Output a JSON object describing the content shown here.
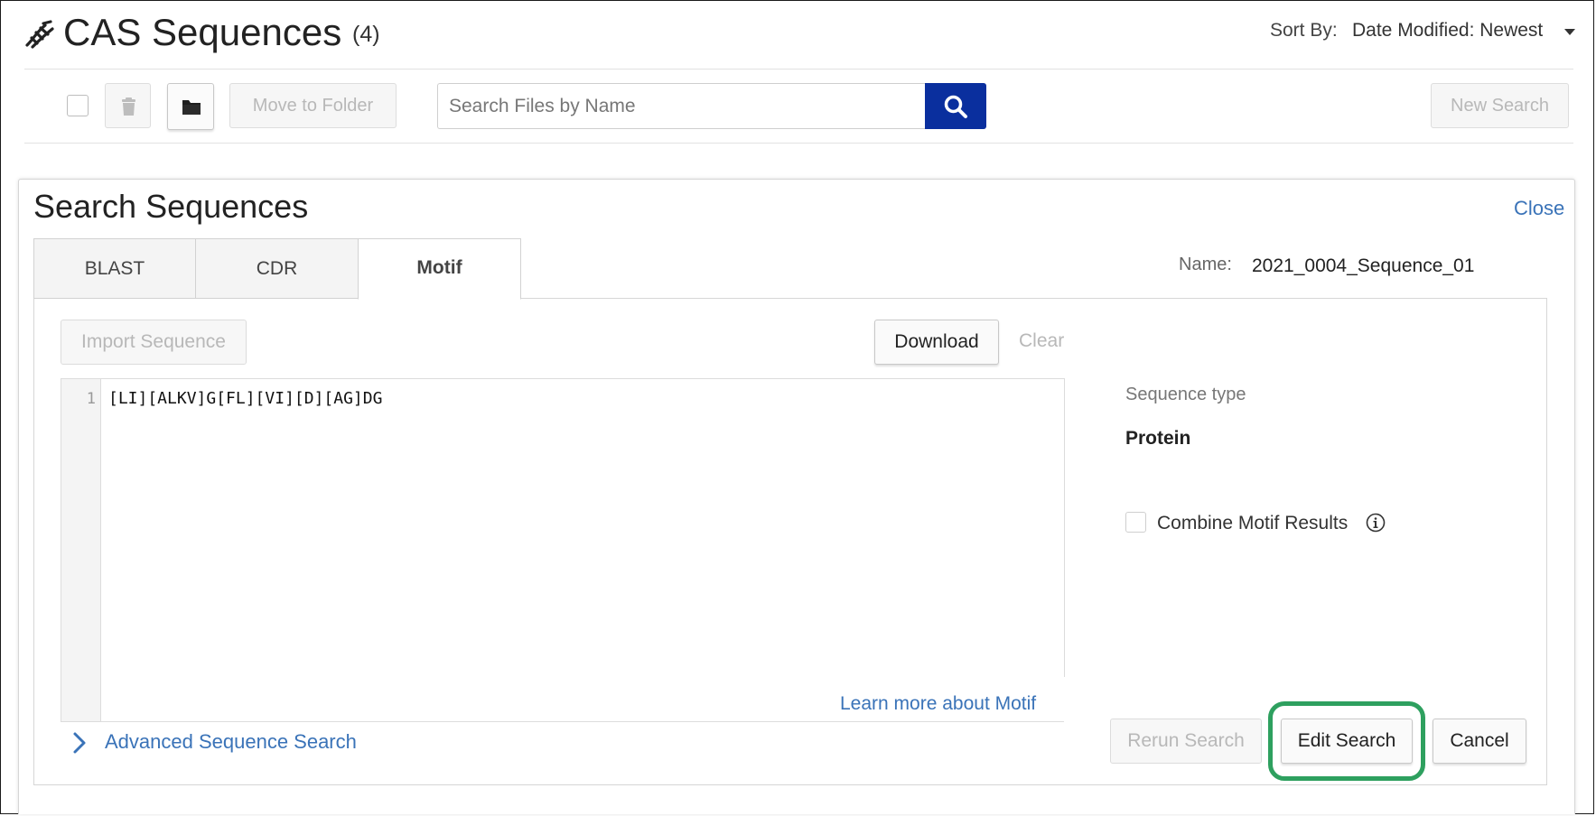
{
  "header": {
    "icon": "dna-icon",
    "title": "CAS Sequences",
    "count": "(4)",
    "sort_label": "Sort By:",
    "sort_value": "Date Modified: Newest"
  },
  "toolbar": {
    "move_to_folder": "Move to Folder",
    "search_placeholder": "Search Files by Name",
    "new_search": "New Search",
    "icons": [
      "trash-icon",
      "folder-icon",
      "search-icon"
    ]
  },
  "panel": {
    "title": "Search Sequences",
    "close": "Close",
    "tabs": [
      {
        "label": "BLAST",
        "active": false
      },
      {
        "label": "CDR",
        "active": false
      },
      {
        "label": "Motif",
        "active": true
      }
    ],
    "name_label": "Name:",
    "name_value": "2021_0004_Sequence_01",
    "import_sequence": "Import Sequence",
    "download": "Download",
    "clear": "Clear",
    "editor": {
      "line_number": "1",
      "line_text": "[LI][ALKV]G[FL][VI][D][AG]DG"
    },
    "learn_more": "Learn more about Motif",
    "sequence_type_label": "Sequence type",
    "sequence_type_value": "Protein",
    "combine_motif_results": "Combine Motif Results",
    "advanced_search": "Advanced Sequence Search",
    "buttons": {
      "rerun": "Rerun Search",
      "edit": "Edit Search",
      "cancel": "Cancel"
    },
    "highlight_color": "#2ea05f"
  },
  "colors": {
    "accent_blue": "#0a2f9e",
    "link": "#3a73b8"
  }
}
